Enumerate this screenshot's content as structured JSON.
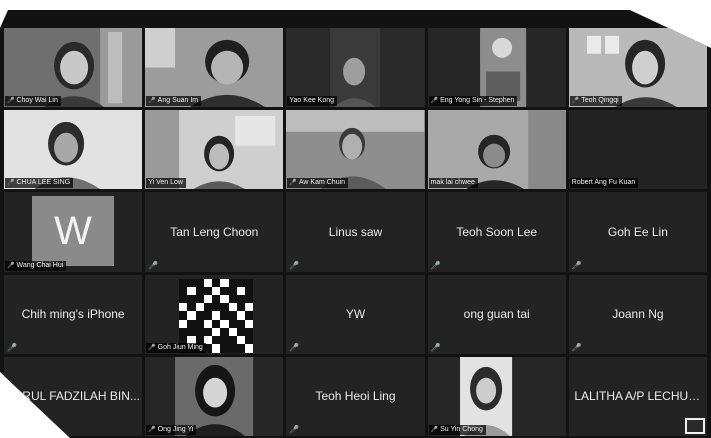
{
  "participants": [
    {
      "name": "Choy Wai Lin",
      "kind": "video"
    },
    {
      "name": "Ang Suan Im",
      "kind": "video"
    },
    {
      "name": "Yao Kee Kong",
      "kind": "video"
    },
    {
      "name": "Eng Yong Sin - Stephen",
      "kind": "video"
    },
    {
      "name": "Teoh Qingqi",
      "kind": "video"
    },
    {
      "name": "CHUA LEE SING",
      "kind": "video"
    },
    {
      "name": "Yi Ven Low",
      "kind": "video"
    },
    {
      "name": "Aw Kam Chuin",
      "kind": "video"
    },
    {
      "name": "mak lai chwee",
      "kind": "video"
    },
    {
      "name": "Robert Ang Fu Kuan",
      "kind": "dark"
    },
    {
      "name": "Wang Chai Hui",
      "kind": "avatar",
      "avatar_letter": "W"
    },
    {
      "name": "Tan Leng Choon",
      "kind": "name"
    },
    {
      "name": "Linus saw",
      "kind": "name"
    },
    {
      "name": "Teoh Soon Lee",
      "kind": "name"
    },
    {
      "name": "Goh Ee Lin",
      "kind": "name"
    },
    {
      "name": "Chih ming's iPhone",
      "kind": "name"
    },
    {
      "name": "Goh Jiun Ming",
      "kind": "qr"
    },
    {
      "name": "YW",
      "kind": "name"
    },
    {
      "name": "ong guan tai",
      "kind": "name"
    },
    {
      "name": "Joann Ng",
      "kind": "name"
    },
    {
      "name": "RUL FADZILAH BIN...",
      "kind": "name"
    },
    {
      "name": "Ong Jing Yi",
      "kind": "photo"
    },
    {
      "name": "Teoh Heoi Ling",
      "kind": "name"
    },
    {
      "name": "Su Yin Chong",
      "kind": "photo"
    },
    {
      "name": "LALITHA A/P LECHUM...",
      "kind": "name"
    }
  ],
  "icons": {
    "mic": "microphone-muted-icon",
    "corner": "gallery-view-icon"
  },
  "colors": {
    "tile_bg": "#232323",
    "window_bg": "#121212",
    "text": "#ececec"
  }
}
